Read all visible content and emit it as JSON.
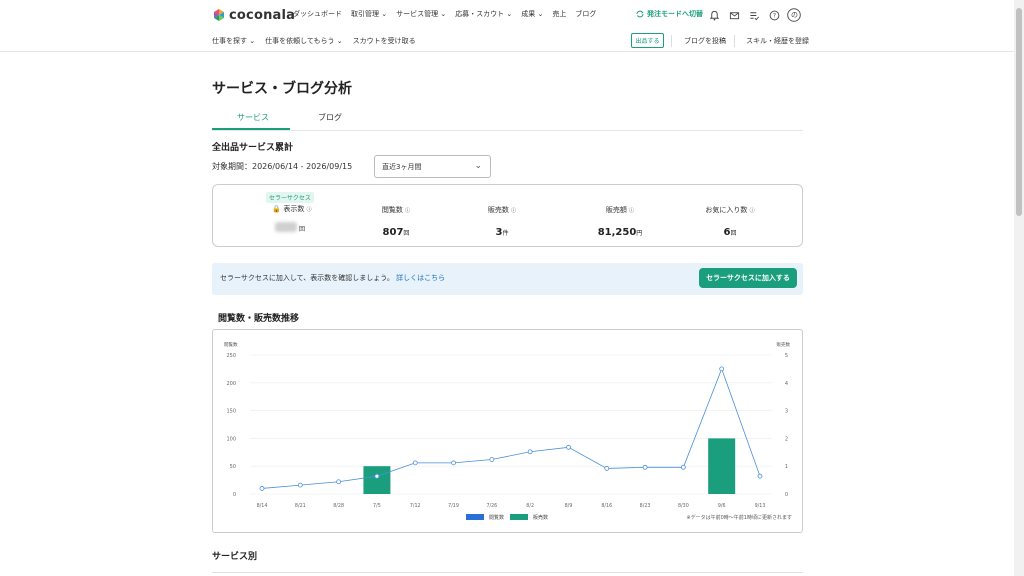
{
  "header": {
    "logo_text": "coconala",
    "nav": [
      "ダッシュボード",
      "取引管理 ⌄",
      "サービス管理 ⌄",
      "応募・スカウト ⌄",
      "成果 ⌄",
      "売上",
      "ブログ"
    ],
    "order_mode": "発注モードへ切替",
    "avatar_initial": "の"
  },
  "subnav": {
    "left": [
      "仕事を探す ⌄",
      "仕事を依頼してもらう ⌄",
      "スカウトを受け取る"
    ],
    "publish_button": "出品する",
    "blog_post": "ブログを投稿",
    "skill_register": "スキル・経歴を登録"
  },
  "page": {
    "title": "サービス・ブログ分析",
    "tabs": [
      "サービス",
      "ブログ"
    ],
    "section_total": "全出品サービス累計",
    "period_label": "対象期間：2026/06/14 - 2026/09/15",
    "period_select": "直近3ヶ月間",
    "section_trend": "閲覧数・販売数推移",
    "section_by_service": "サービス別"
  },
  "stats": {
    "badge": "セラーサクセス",
    "items": [
      {
        "label": "表示数",
        "value": "",
        "unit": "回"
      },
      {
        "label": "閲覧数",
        "value": "807",
        "unit": "回"
      },
      {
        "label": "販売数",
        "value": "3",
        "unit": "件"
      },
      {
        "label": "販売額",
        "value": "81,250",
        "unit": "円"
      },
      {
        "label": "お気に入り数",
        "value": "6",
        "unit": "回"
      }
    ]
  },
  "banner": {
    "text": "セラーサクセスに加入して、表示数を確認しましょう。",
    "link": "詳しくはこちら",
    "button": "セラーサクセスに加入する"
  },
  "chart_data": {
    "type": "bar+line",
    "x": [
      "8/14",
      "8/21",
      "8/28",
      "7/5",
      "7/12",
      "7/19",
      "7/26",
      "8/2",
      "8/9",
      "8/16",
      "8/23",
      "8/30",
      "9/6",
      "9/13"
    ],
    "left_axis_label": "閲覧数",
    "right_axis_label": "販売数",
    "left_ticks": [
      "250",
      "200",
      "150",
      "100",
      "50",
      "0"
    ],
    "right_ticks": [
      "5",
      "4",
      "3",
      "2",
      "1",
      "0"
    ],
    "ylim_left": [
      0,
      250
    ],
    "ylim_right": [
      0,
      5
    ],
    "series": [
      {
        "name": "閲覧数",
        "type": "line",
        "color": "#4a90d9",
        "values": [
          10,
          16,
          22,
          32,
          56,
          56,
          62,
          76,
          84,
          46,
          48,
          48,
          225,
          32
        ]
      },
      {
        "name": "販売数",
        "type": "bar",
        "color": "#1a9e7d",
        "values": [
          0,
          0,
          0,
          1,
          0,
          0,
          0,
          0,
          0,
          0,
          0,
          0,
          2,
          0
        ]
      }
    ],
    "legend": [
      "閲覧数",
      "販売数"
    ],
    "legend_colors": [
      "#2a6fd6",
      "#1a9e7d"
    ],
    "note": "※データは午前0時〜午前1時頃に更新されます"
  }
}
